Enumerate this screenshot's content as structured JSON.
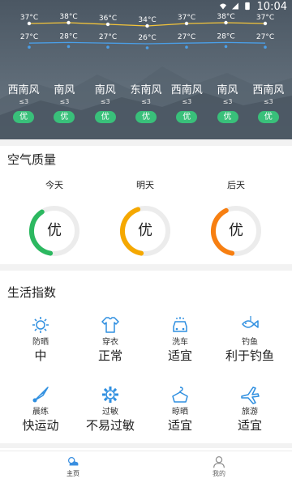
{
  "status_bar": {
    "time": "10:04"
  },
  "forecast": {
    "high_temps": [
      "37°C",
      "38°C",
      "36°C",
      "34°C",
      "37°C",
      "38°C",
      "37°C"
    ],
    "low_temps": [
      "27°C",
      "28°C",
      "27°C",
      "26°C",
      "27°C",
      "28°C",
      "27°C"
    ],
    "high_line_color": "#f5c53a",
    "low_line_color": "#4a9fe8",
    "days": [
      {
        "wind_dir": "西南风",
        "wind_level": "≤3",
        "aqi": "优"
      },
      {
        "wind_dir": "南风",
        "wind_level": "≤3",
        "aqi": "优"
      },
      {
        "wind_dir": "南风",
        "wind_level": "≤3",
        "aqi": "优"
      },
      {
        "wind_dir": "东南风",
        "wind_level": "≤3",
        "aqi": "优"
      },
      {
        "wind_dir": "西南风",
        "wind_level": "≤3",
        "aqi": "优"
      },
      {
        "wind_dir": "南风",
        "wind_level": "≤3",
        "aqi": "优"
      },
      {
        "wind_dir": "西南风",
        "wind_level": "≤3",
        "aqi": "优"
      }
    ],
    "aqi_pill_color": "#39c07a"
  },
  "air_quality": {
    "title": "空气质量",
    "days": [
      {
        "label": "今天",
        "value": "优",
        "color": "#2cb860",
        "level": 0.38
      },
      {
        "label": "明天",
        "value": "优",
        "color": "#f5a800",
        "level": 0.42
      },
      {
        "label": "后天",
        "value": "优",
        "color": "#f77f11",
        "level": 0.4
      }
    ],
    "track_color": "#ececec"
  },
  "life_index": {
    "title": "生活指数",
    "icon_color": "#2f8fe0",
    "items": [
      {
        "icon": "sun-icon",
        "name": "防晒",
        "value": "中"
      },
      {
        "icon": "shirt-icon",
        "name": "穿衣",
        "value": "正常"
      },
      {
        "icon": "car-wash-icon",
        "name": "洗车",
        "value": "适宜"
      },
      {
        "icon": "fish-icon",
        "name": "钓鱼",
        "value": "利于钓鱼"
      },
      {
        "icon": "badminton-icon",
        "name": "晨练",
        "value": "快运动"
      },
      {
        "icon": "allergy-gear-icon",
        "name": "过敏",
        "value": "不易过敏"
      },
      {
        "icon": "hanger-icon",
        "name": "晾晒",
        "value": "适宜"
      },
      {
        "icon": "plane-icon",
        "name": "旅游",
        "value": "适宜"
      }
    ]
  },
  "bottom_nav": {
    "items": [
      {
        "icon": "weather-home-icon",
        "label": "主页"
      },
      {
        "icon": "person-icon",
        "label": "我的"
      }
    ]
  }
}
